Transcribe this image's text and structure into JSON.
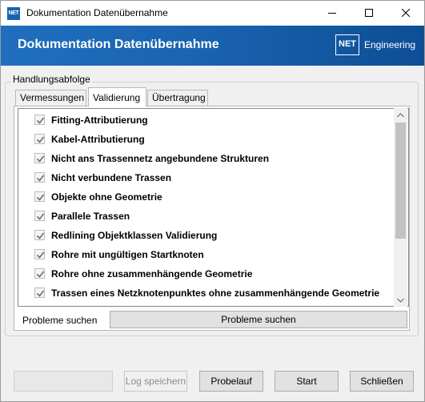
{
  "window": {
    "title": "Dokumentation Datenübernahme",
    "icon_text": "NET"
  },
  "banner": {
    "title": "Dokumentation Datenübernahme",
    "logo_box": "NET",
    "logo_text": "Engineering"
  },
  "group": {
    "label": "Handlungsabfolge"
  },
  "tabs": [
    {
      "label": "Vermessungen"
    },
    {
      "label": "Validierung",
      "selected": true
    },
    {
      "label": "Übertragung"
    }
  ],
  "checks": [
    {
      "label": "Fitting-Attributierung",
      "checked": true
    },
    {
      "label": "Kabel-Attributierung",
      "checked": true
    },
    {
      "label": "Nicht ans Trassennetz angebundene Strukturen",
      "checked": true
    },
    {
      "label": "Nicht verbundene Trassen",
      "checked": true
    },
    {
      "label": "Objekte ohne Geometrie",
      "checked": true
    },
    {
      "label": "Parallele Trassen",
      "checked": true
    },
    {
      "label": "Redlining Objektklassen Validierung",
      "checked": true
    },
    {
      "label": "Rohre mit ungültigen Startknoten",
      "checked": true
    },
    {
      "label": "Rohre ohne zusammenhängende Geometrie",
      "checked": true
    },
    {
      "label": "Trassen eines Netzknotenpunktes ohne zusammenhängende Geometrie",
      "checked": true
    }
  ],
  "search": {
    "label": "Probleme suchen",
    "button": "Probleme suchen"
  },
  "footer": {
    "log_button": "Log speichern",
    "probe_button": "Probelauf",
    "start_button": "Start",
    "close_button": "Schließen"
  },
  "colors": {
    "banner": "#1a64b0",
    "checkmark": "#6e6e6e"
  }
}
